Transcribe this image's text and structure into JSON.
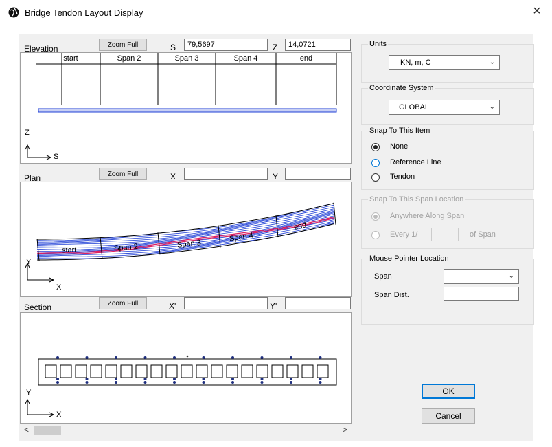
{
  "window": {
    "title": "Bridge Tendon Layout Display",
    "close_glyph": "×"
  },
  "elevation": {
    "label": "Elevation",
    "zoom_label": "Zoom Full",
    "coord1_label": "S",
    "coord1_value": "79,5697",
    "coord2_label": "Z",
    "coord2_value": "14,0721",
    "spans": [
      "start",
      "Span 2",
      "Span 3",
      "Span 4",
      "end"
    ],
    "axis_v": "Z",
    "axis_h": "S"
  },
  "plan": {
    "label": "Plan",
    "zoom_label": "Zoom Full",
    "coord1_label": "X",
    "coord1_value": "",
    "coord2_label": "Y",
    "coord2_value": "",
    "spans": [
      "start",
      "Span 2",
      "Span 3",
      "Span 4",
      "end"
    ],
    "axis_v": "Y",
    "axis_h": "X"
  },
  "section": {
    "label": "Section",
    "zoom_label": "Zoom Full",
    "coord1_label": "X'",
    "coord1_value": "",
    "coord2_label": "Y'",
    "coord2_value": "",
    "axis_v": "Y'",
    "axis_h": "X'",
    "cell_count": 19
  },
  "scroll": {
    "left": "<",
    "right": ">"
  },
  "units": {
    "title": "Units",
    "value": "KN, m, C"
  },
  "coordinate_system": {
    "title": "Coordinate System",
    "value": "GLOBAL"
  },
  "snap_item": {
    "title": "Snap To This Item",
    "options": [
      "None",
      "Reference Line",
      "Tendon"
    ],
    "selected": "None"
  },
  "snap_span": {
    "title": "Snap To This Span Location",
    "option1": "Anywhere Along Span",
    "option2": "Every 1/",
    "every_value": "",
    "suffix": "of Span",
    "selected": "Anywhere Along Span"
  },
  "mouse": {
    "title": "Mouse Pointer Location",
    "span_label": "Span",
    "span_value": "",
    "dist_label": "Span Dist.",
    "dist_value": ""
  },
  "buttons": {
    "ok": "OK",
    "cancel": "Cancel"
  },
  "icons": {
    "app": "app-globe-icon",
    "chevron": "chevron-down-icon"
  },
  "colors": {
    "tendon_blue": "#1f3fd6",
    "tendon_red": "#e02060",
    "accent": "#0078d7"
  }
}
